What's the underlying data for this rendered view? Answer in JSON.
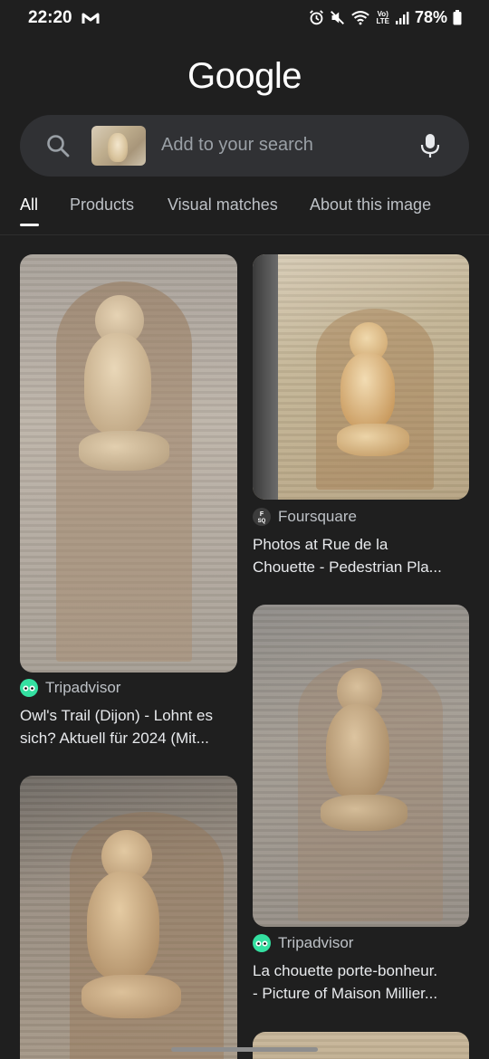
{
  "status": {
    "time": "22:20",
    "battery": "78%",
    "network": "LTE"
  },
  "header": {
    "logo": "Google"
  },
  "search": {
    "placeholder": "Add to your search",
    "search_icon": "search-icon",
    "mic_icon": "mic-icon"
  },
  "tabs": [
    {
      "label": "All",
      "active": true
    },
    {
      "label": "Products",
      "active": false
    },
    {
      "label": "Visual matches",
      "active": false
    },
    {
      "label": "About this image",
      "active": false
    }
  ],
  "results": [
    {
      "source": "Tripadvisor",
      "title_line1": "Owl's Trail (Dijon) - Lohnt es",
      "title_line2": "sich? Aktuell für 2024 (Mit..."
    },
    {
      "source": "Foursquare",
      "title_line1": "Photos at Rue de la",
      "title_line2": "Chouette - Pedestrian Pla..."
    },
    {
      "source": "Tripadvisor",
      "title_line1": "La chouette porte-bonheur.",
      "title_line2": "- Picture of Maison Millier..."
    },
    {
      "source": "",
      "title_line1": "",
      "title_line2": ""
    },
    {
      "source": "",
      "title_line1": "",
      "title_line2": ""
    }
  ],
  "colors": {
    "background": "#1f1f1f",
    "search_bar": "#303134",
    "tripadvisor_green": "#34e0a1"
  }
}
